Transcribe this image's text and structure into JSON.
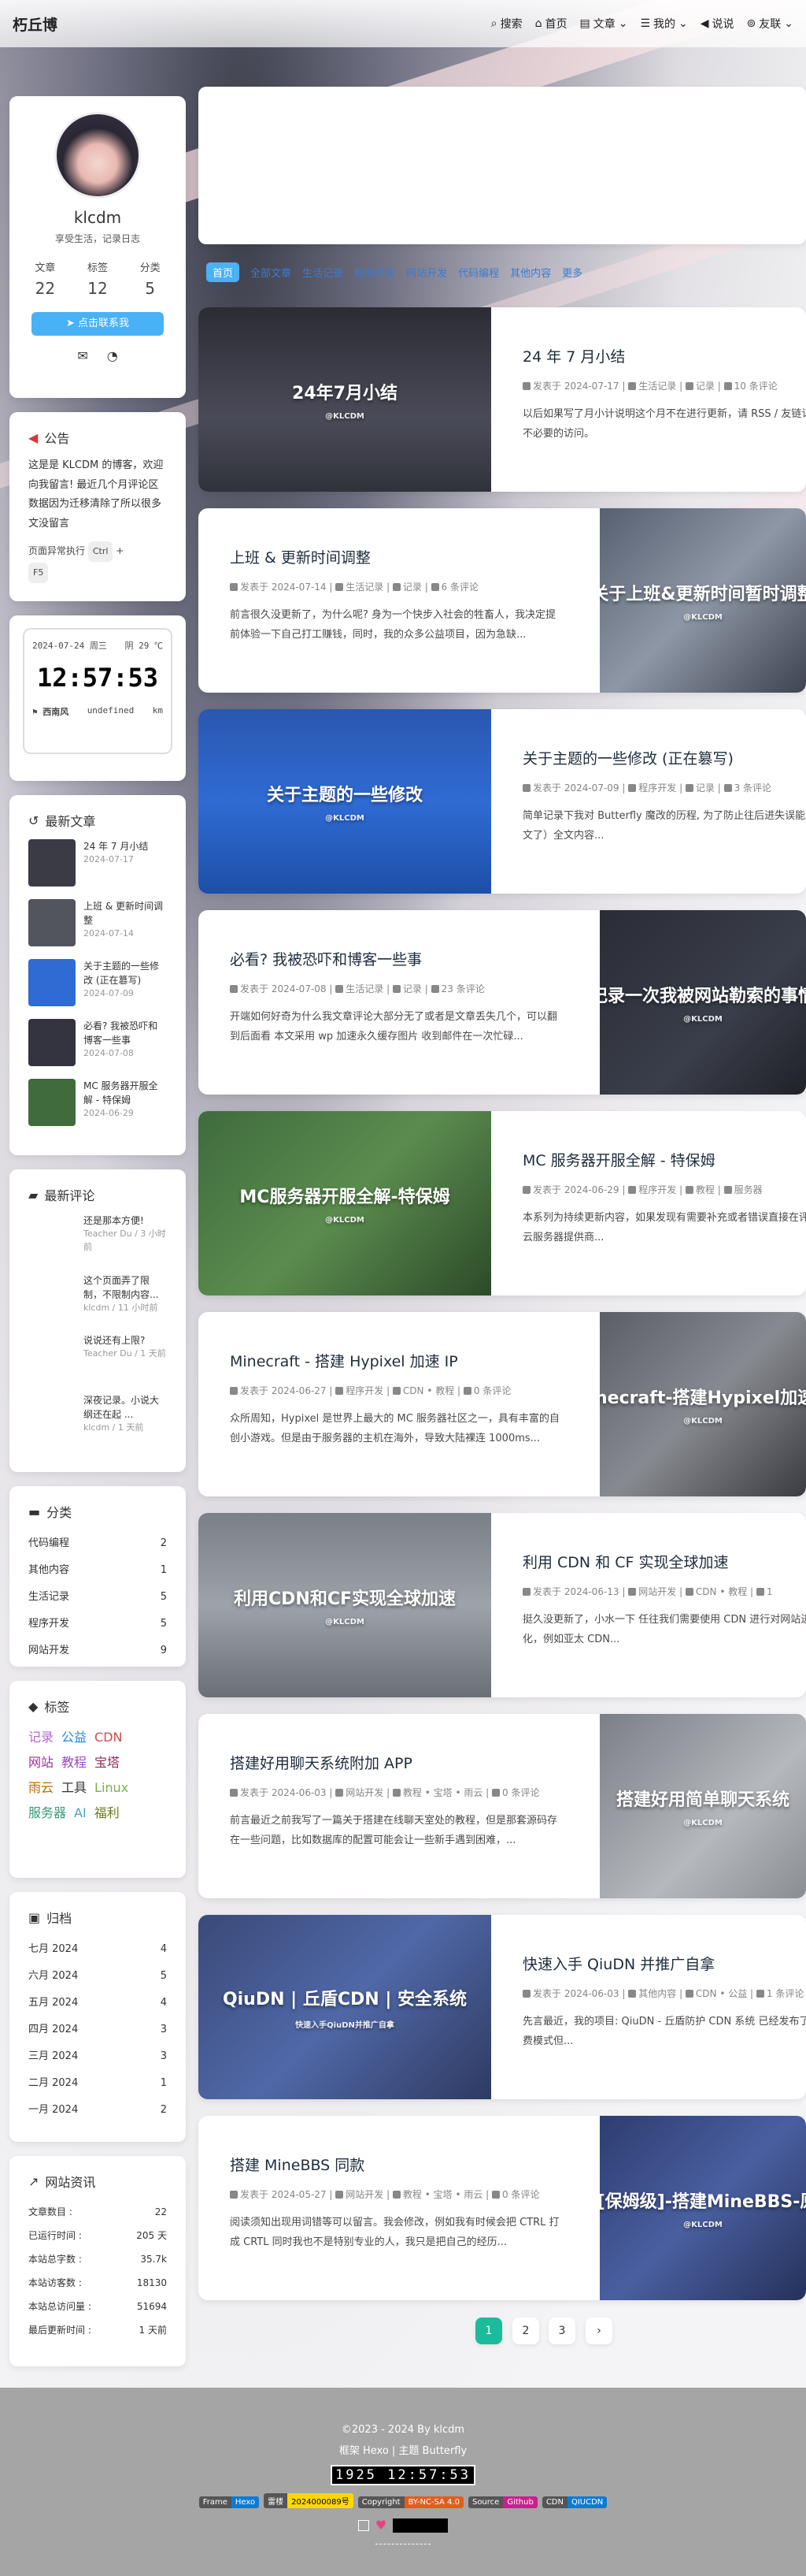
{
  "nav": {
    "brand": "朽丘博",
    "items": [
      "搜索",
      "首页",
      "文章",
      "我的",
      "说说",
      "友联"
    ]
  },
  "colors": {
    "accent": "#49b1f5",
    "pink": "#e8c3c9"
  },
  "profile": {
    "name": "klcdm",
    "motto": "享受生活，记录日志",
    "stats": [
      {
        "label": "文章",
        "value": "22"
      },
      {
        "label": "标签",
        "value": "12"
      },
      {
        "label": "分类",
        "value": "5"
      }
    ],
    "contact_label": "点击联系我"
  },
  "notice": {
    "title": "公告",
    "text": "这是是 KLCDM 的博客，欢迎向我留言! 最近几个月评论区数据因为迁移清除了所以很多文没留言",
    "hint_prefix": "页面异常执行",
    "key1": "Ctrl",
    "plus": "+",
    "key2": "F5"
  },
  "clock": {
    "date": "2024-07-24 周三",
    "weather": "阴 29 ℃",
    "time": "12:57:53",
    "wind": "西南风",
    "aqi": "undefined",
    "unit": "km"
  },
  "recent_posts": {
    "title": "最新文章",
    "items": [
      {
        "title": "24 年 7 月小结",
        "date": "2024-07-17"
      },
      {
        "title": "上班 & 更新时间调整",
        "date": "2024-07-14"
      },
      {
        "title": "关于主题的一些修改 (正在篡写)",
        "date": "2024-07-09"
      },
      {
        "title": "必看? 我被恐吓和博客一些事",
        "date": "2024-07-08"
      },
      {
        "title": "MC 服务器开服全解 - 特保姆",
        "date": "2024-06-29"
      }
    ]
  },
  "recent_comments": {
    "title": "最新评论",
    "items": [
      {
        "text": "还是那本方便!",
        "meta": "Teacher Du / 3 小时前"
      },
      {
        "text": "这个页面弄了限制，不限制内容...",
        "meta": "klcdm / 11 小时前"
      },
      {
        "text": "说说还有上限?",
        "meta": "Teacher Du / 1 天前"
      },
      {
        "text": "深夜记录。小说大纲还在起 ...",
        "meta": "klcdm / 1 天前"
      }
    ]
  },
  "categories": {
    "title": "分类",
    "items": [
      {
        "name": "代码编程",
        "count": "2"
      },
      {
        "name": "其他内容",
        "count": "1"
      },
      {
        "name": "生活记录",
        "count": "5"
      },
      {
        "name": "程序开发",
        "count": "5"
      },
      {
        "name": "网站开发",
        "count": "9"
      }
    ]
  },
  "tags": {
    "title": "标签",
    "items": [
      {
        "name": "记录",
        "color": "#b866cc"
      },
      {
        "name": "公益",
        "color": "#2a8ad6"
      },
      {
        "name": "CDN",
        "color": "#d04b4b"
      },
      {
        "name": "网站",
        "color": "#a0309a"
      },
      {
        "name": "教程",
        "color": "#9a48c0"
      },
      {
        "name": "宝塔",
        "color": "#8a2d58"
      },
      {
        "name": "雨云",
        "color": "#b36e00"
      },
      {
        "name": "工具",
        "color": "#333"
      },
      {
        "name": "Linux",
        "color": "#7ab04a"
      },
      {
        "name": "服务器",
        "color": "#3a9a78"
      },
      {
        "name": "AI",
        "color": "#46a6b8"
      },
      {
        "name": "福利",
        "color": "#6a7a1e"
      }
    ]
  },
  "archives": {
    "title": "归档",
    "items": [
      {
        "name": "七月 2024",
        "count": "4"
      },
      {
        "name": "六月 2024",
        "count": "5"
      },
      {
        "name": "五月 2024",
        "count": "4"
      },
      {
        "name": "四月 2024",
        "count": "3"
      },
      {
        "name": "三月 2024",
        "count": "3"
      },
      {
        "name": "二月 2024",
        "count": "1"
      },
      {
        "name": "一月 2024",
        "count": "2"
      }
    ]
  },
  "site_info": {
    "title": "网站资讯",
    "items": [
      {
        "k": "文章数目 :",
        "v": "22"
      },
      {
        "k": "已运行时间 :",
        "v": "205 天"
      },
      {
        "k": "本站总字数 :",
        "v": "35.7k"
      },
      {
        "k": "本站访客数 :",
        "v": "18130"
      },
      {
        "k": "本站总访问量 :",
        "v": "51694"
      },
      {
        "k": "最后更新时间 :",
        "v": "1 天前"
      }
    ]
  },
  "filter_tabs": [
    "首页",
    "全部文章",
    "生活记录",
    "程序开发",
    "网站开发",
    "代码编程",
    "其他内容",
    "更多"
  ],
  "posts": [
    {
      "title": "24 年 7 月小结",
      "date": "发表于 2024-07-17",
      "cats": "生活记录",
      "tags": "记录",
      "comments": "10 条评论",
      "desc": "以后如果写了月小计说明这个月不在进行更新，请 RSS / 友链订阅 是看到我写了小结可以接下来这个月内不用互访避免了不必要的访问。",
      "cover_title": "24年7月小结",
      "cover_sub": "@KLCDM"
    },
    {
      "title": "上班 & 更新时间调整",
      "date": "发表于 2024-07-14",
      "cats": "生活记录",
      "tags": "记录",
      "comments": "6 条评论",
      "desc": "前言很久没更新了，为什么呢? 身为一个快步入社会的牲畜人，我决定提前体验一下自己打工赚钱，同时，我的众多公益项目，因为急缺...",
      "cover_title": "关于上班&更新时间暂时调整",
      "cover_sub": "@KLCDM"
    },
    {
      "title": "关于主题的一些修改 (正在篡写)",
      "date": "发表于 2024-07-09",
      "cats": "程序开发",
      "tags": "记录",
      "comments": "3 条评论",
      "desc": "简单记录下我对 Butterfly 魔改的历程, 为了防止往后进失误能及时找回或是搬运文章方便我个人记录回溯，并且标注好原文了）全文内容...",
      "cover_title": "关于主题的一些修改",
      "cover_sub": "@KLCDM"
    },
    {
      "title": "必看? 我被恐吓和博客一些事",
      "date": "发表于 2024-07-08",
      "cats": "生活记录",
      "tags": "记录",
      "comments": "23 条评论",
      "desc": "开端如何好奇为什么我文章评论大部分无了或者是文章丢失几个，可以翻到后面看 本文采用 wp 加速永久缓存图片 收到邮件在一次忙碌...",
      "cover_title": "记录一次我被网站勒索的事情",
      "cover_sub": "@KLCDM"
    },
    {
      "title": "MC 服务器开服全解 - 特保姆",
      "date": "发表于 2024-06-29",
      "cats": "程序开发",
      "tags": "教程",
      "comments": "服务器",
      "desc": "本系列为持续更新内容，如果发现有需要补充或者错误直接在评论区里平台都会进行更新修复内容 本文基于 雨云 · 新一代云服务器提供商...",
      "cover_title": "MC服务器开服全解-特保姆",
      "cover_sub": "@KLCDM"
    },
    {
      "title": "Minecraft - 搭建 Hypixel 加速 IP",
      "date": "发表于 2024-06-27",
      "cats": "程序开发",
      "tags": "CDN • 教程",
      "comments": "0 条评论",
      "desc": "众所周知，Hypixel 是世界上最大的 MC 服务器社区之一，具有丰富的自创小游戏。但是由于服务器的主机在海外，导致大陆裸连 1000ms...",
      "cover_title": "Minecraft-搭建Hypixel加速IP",
      "cover_sub": "@KLCDM"
    },
    {
      "title": "利用 CDN 和 CF 实现全球加速",
      "date": "发表于 2024-06-13",
      "cats": "网站开发",
      "tags": "CDN • 教程",
      "comments": "1",
      "desc": "挺久没更新了，小水一下 任往我们需要使用 CDN 进行对网站进行加速和保护，但是很多 CDN 是对标一个地区进行优化，例如亚太 CDN...",
      "cover_title": "利用CDN和CF实现全球加速",
      "cover_sub": "@KLCDM"
    },
    {
      "title": "搭建好用聊天系统附加 APP",
      "date": "发表于 2024-06-03",
      "cats": "网站开发",
      "tags": "教程 • 宝塔 • 雨云",
      "comments": "0 条评论",
      "desc": "前言最近之前我写了一篇关于搭建在线聊天室处的教程，但是那套源码存在一些问题，比如数据库的配置可能会让一些新手遇到困难，...",
      "cover_title": "搭建好用简单聊天系统",
      "cover_sub": "@KLCDM"
    },
    {
      "title": "快速入手 QiuDN 并推广自拿",
      "date": "发表于 2024-06-03",
      "cats": "其他内容",
      "tags": "CDN • 公益",
      "comments": "1 条评论",
      "desc": "先言最近，我的项目: QiuDN - 丘盾防护 CDN 系统 已经发布了，目前节点也上两，开启了付费模式运营，虽然添加了付费模式但...",
      "cover_title": "QiuDN | 丘盾CDN | 安全系统",
      "cover_sub": "快速入手QiuDN并推广自拿"
    },
    {
      "title": "搭建 MineBBS 同款",
      "date": "发表于 2024-05-27",
      "cats": "网站开发",
      "tags": "教程 • 宝塔 • 雨云",
      "comments": "0 条评论",
      "desc": "阅读须知出现用词错等可以留言。我会修改，例如我有时候会把 CTRL 打成 CRTL 同时我也不是特别专业的人，我只是把自己的经历...",
      "cover_title": "[真][保姆级]-搭建MineBBS-原创-",
      "cover_sub": "@KLCDM"
    }
  ],
  "pagination": [
    "1",
    "2",
    "3"
  ],
  "footer": {
    "copy": "©2023 - 2024 By klcdm",
    "frame": "框架 Hexo | 主题 Butterfly",
    "counter": "1925 12:57:53",
    "badges": [
      {
        "l": "Frame",
        "r": "Hexo"
      },
      {
        "l": "雷楼",
        "r": "2024000089号"
      },
      {
        "l": "Copyright",
        "r": "BY-NC-SA 4.0"
      },
      {
        "l": "Source",
        "r": "Github"
      },
      {
        "l": "CDN",
        "r": "QIUCDN"
      }
    ]
  }
}
